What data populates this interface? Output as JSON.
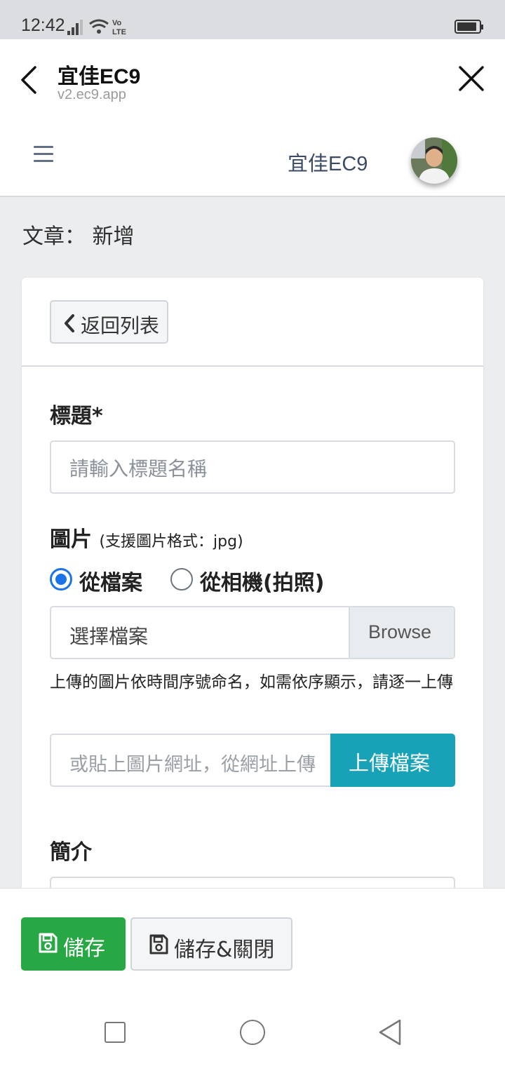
{
  "status_bar": {
    "time": "12:42",
    "network": "Vo LTE"
  },
  "browser": {
    "title": "宜佳EC9",
    "url": "v2.ec9.app"
  },
  "app_header": {
    "brand": "宜佳EC9"
  },
  "page": {
    "title": "文章： 新增"
  },
  "card": {
    "back_button": "返回列表",
    "title_label": "標題*",
    "title_placeholder": "請輸入標題名稱",
    "image_label": "圖片",
    "image_hint": "(支援圖片格式：jpg)",
    "radio_options": [
      {
        "label": "從檔案",
        "checked": true
      },
      {
        "label": "從相機(拍照)",
        "checked": false
      }
    ],
    "file_placeholder": "選擇檔案",
    "browse_label": "Browse",
    "upload_help": "上傳的圖片依時間序號命名，如需依序顯示，請逐一上傳",
    "url_placeholder": "或貼上圖片網址，從網址上傳",
    "upload_button": "上傳檔案",
    "summary_label": "簡介"
  },
  "actions": {
    "save": "儲存",
    "save_close": "儲存&關閉"
  },
  "colors": {
    "primary_green": "#28a745",
    "info_teal": "#17a2b8",
    "radio_blue": "#1a73e8"
  },
  "battery_level": 0.9
}
